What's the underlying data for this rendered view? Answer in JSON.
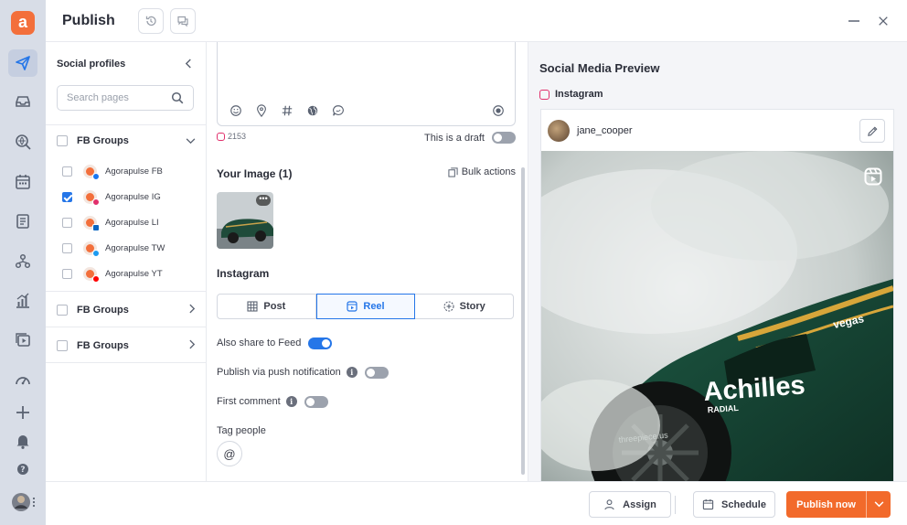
{
  "app": {
    "logo_letter": "a",
    "accent": "#f36f3b",
    "primary": "#2576e8"
  },
  "rail": {
    "items": [
      {
        "icon": "send-icon",
        "active": true
      },
      {
        "icon": "inbox-icon"
      },
      {
        "icon": "listen-icon"
      },
      {
        "icon": "calendar-icon"
      },
      {
        "icon": "list-icon"
      },
      {
        "icon": "team-icon"
      },
      {
        "icon": "reports-icon"
      },
      {
        "icon": "media-icon"
      },
      {
        "icon": "speed-icon"
      },
      {
        "icon": "plus-icon"
      },
      {
        "icon": "bell-icon"
      },
      {
        "icon": "help-icon"
      }
    ]
  },
  "header": {
    "title": "Publish"
  },
  "profiles": {
    "title": "Social profiles",
    "search_placeholder": "Search pages",
    "groups": [
      {
        "label": "FB Groups",
        "expanded": true,
        "items": [
          {
            "label": "Agorapulse FB",
            "network": "facebook",
            "color": "#1877f2",
            "checked": false
          },
          {
            "label": "Agorapulse IG",
            "network": "instagram",
            "color": "#e1306c",
            "checked": true
          },
          {
            "label": "Agorapulse LI",
            "network": "linkedin",
            "color": "#0a66c2",
            "checked": false
          },
          {
            "label": "Agorapulse TW",
            "network": "twitter",
            "color": "#1d9bf0",
            "checked": false
          },
          {
            "label": "Agorapulse YT",
            "network": "youtube",
            "color": "#ff0000",
            "checked": false
          }
        ]
      },
      {
        "label": "FB Groups",
        "expanded": false
      },
      {
        "label": "FB Groups",
        "expanded": false
      }
    ]
  },
  "composer": {
    "char_count": "2153",
    "draft_label": "This is a draft",
    "draft_on": false,
    "image_title": "Your Image (1)",
    "bulk_actions": "Bulk actions",
    "instagram_title": "Instagram",
    "tabs": [
      {
        "label": "Post",
        "icon": "grid-icon",
        "active": false
      },
      {
        "label": "Reel",
        "icon": "reel-icon",
        "active": true
      },
      {
        "label": "Story",
        "icon": "story-icon",
        "active": false
      }
    ],
    "options": {
      "share_feed": {
        "label": "Also share to Feed",
        "on": true
      },
      "push": {
        "label": "Publish via push notification",
        "on": false
      },
      "first_comment": {
        "label": "First comment",
        "on": false
      }
    },
    "tag_people": "Tag people"
  },
  "preview": {
    "title": "Social Media Preview",
    "network": "Instagram",
    "username": "jane_cooper",
    "car_text": "Achilles",
    "car_sub": "RADIAL",
    "car_brand": "vegas",
    "car_small": "threepiece.us"
  },
  "footer": {
    "assign": "Assign",
    "schedule": "Schedule",
    "publish_now": "Publish now"
  }
}
